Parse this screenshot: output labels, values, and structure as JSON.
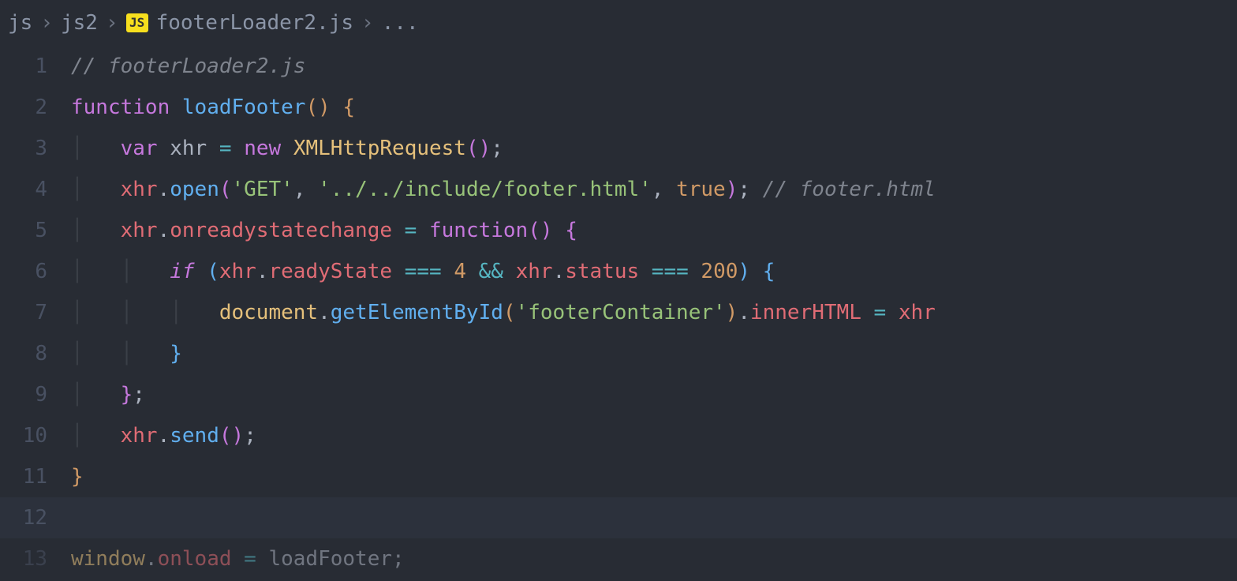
{
  "breadcrumbs": {
    "item0": "js",
    "item1": "js2",
    "item2": "footerLoader2.js",
    "item3": "...",
    "js_badge": "JS"
  },
  "gutter": {
    "l1": "1",
    "l2": "2",
    "l3": "3",
    "l4": "4",
    "l5": "5",
    "l6": "6",
    "l7": "7",
    "l8": "8",
    "l9": "9",
    "l10": "10",
    "l11": "11",
    "l12": "12",
    "l13": "13"
  },
  "code": {
    "l1_comment": "// footerLoader2.js",
    "l2_function": "function",
    "l2_name": "loadFooter",
    "l3_var": "var",
    "l3_xhr": "xhr",
    "l3_new": "new",
    "l3_class": "XMLHttpRequest",
    "l4_xhr": "xhr",
    "l4_open": "open",
    "l4_get": "'GET'",
    "l4_path": "'../../include/footer.html'",
    "l4_true": "true",
    "l4_comment": "// footer.html",
    "l5_xhr": "xhr",
    "l5_onready": "onreadystatechange",
    "l5_function": "function",
    "l6_if": "if",
    "l6_xhr1": "xhr",
    "l6_readyState": "readyState",
    "l6_eq1": "===",
    "l6_4": "4",
    "l6_and": "&&",
    "l6_xhr2": "xhr",
    "l6_status": "status",
    "l6_eq2": "===",
    "l6_200": "200",
    "l7_document": "document",
    "l7_getById": "getElementById",
    "l7_fc": "'footerContainer'",
    "l7_innerHTML": "innerHTML",
    "l7_xhr": "xhr",
    "l10_xhr": "xhr",
    "l10_send": "send",
    "l13_window": "window",
    "l13_onload": "onload",
    "l13_loadFooter": "loadFooter"
  }
}
